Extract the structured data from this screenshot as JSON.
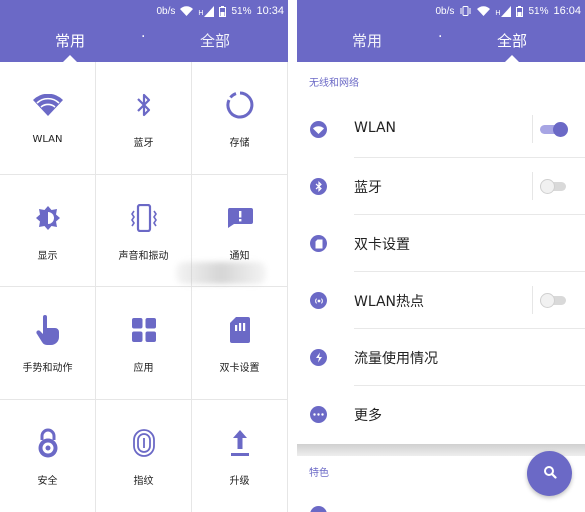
{
  "colors": {
    "accent": "#6b69c6",
    "accent_light": "#a7a5e4",
    "divider": "#e6e6e6",
    "text": "#222222"
  },
  "left": {
    "status": {
      "speed": "0b/s",
      "signal": "H",
      "battery": "51%",
      "time": "10:34"
    },
    "tabs": {
      "common": "常用",
      "dot": "·",
      "all": "全部"
    },
    "grid": [
      {
        "label": "WLAN",
        "icon": "wifi-icon"
      },
      {
        "label": "蓝牙",
        "icon": "bluetooth-icon"
      },
      {
        "label": "存储",
        "icon": "storage-icon"
      },
      {
        "label": "显示",
        "icon": "brightness-icon"
      },
      {
        "label": "声音和振动",
        "icon": "vibrate-icon"
      },
      {
        "label": "通知",
        "icon": "notification-icon"
      },
      {
        "label": "手势和动作",
        "icon": "gesture-icon"
      },
      {
        "label": "应用",
        "icon": "apps-icon"
      },
      {
        "label": "双卡设置",
        "icon": "sim-card-icon"
      },
      {
        "label": "安全",
        "icon": "lock-icon"
      },
      {
        "label": "指纹",
        "icon": "fingerprint-icon"
      },
      {
        "label": "升级",
        "icon": "upgrade-icon"
      }
    ]
  },
  "right": {
    "status": {
      "speed": "0b/s",
      "signal": "H",
      "battery": "51%",
      "time": "16:04"
    },
    "tabs": {
      "common": "常用",
      "dot": "·",
      "all": "全部"
    },
    "section_wireless": "无线和网络",
    "rows": [
      {
        "label": "WLAN",
        "icon": "wifi-icon",
        "toggle": "on"
      },
      {
        "label": "蓝牙",
        "icon": "bluetooth-icon",
        "toggle": "off"
      },
      {
        "label": "双卡设置",
        "icon": "sim-card-icon",
        "toggle": "none"
      },
      {
        "label": "WLAN热点",
        "icon": "hotspot-icon",
        "toggle": "off"
      },
      {
        "label": "流量使用情况",
        "icon": "data-usage-icon",
        "toggle": "none"
      },
      {
        "label": "更多",
        "icon": "more-icon",
        "toggle": "none"
      }
    ],
    "section_features": "特色",
    "fab_icon": "search-icon"
  }
}
